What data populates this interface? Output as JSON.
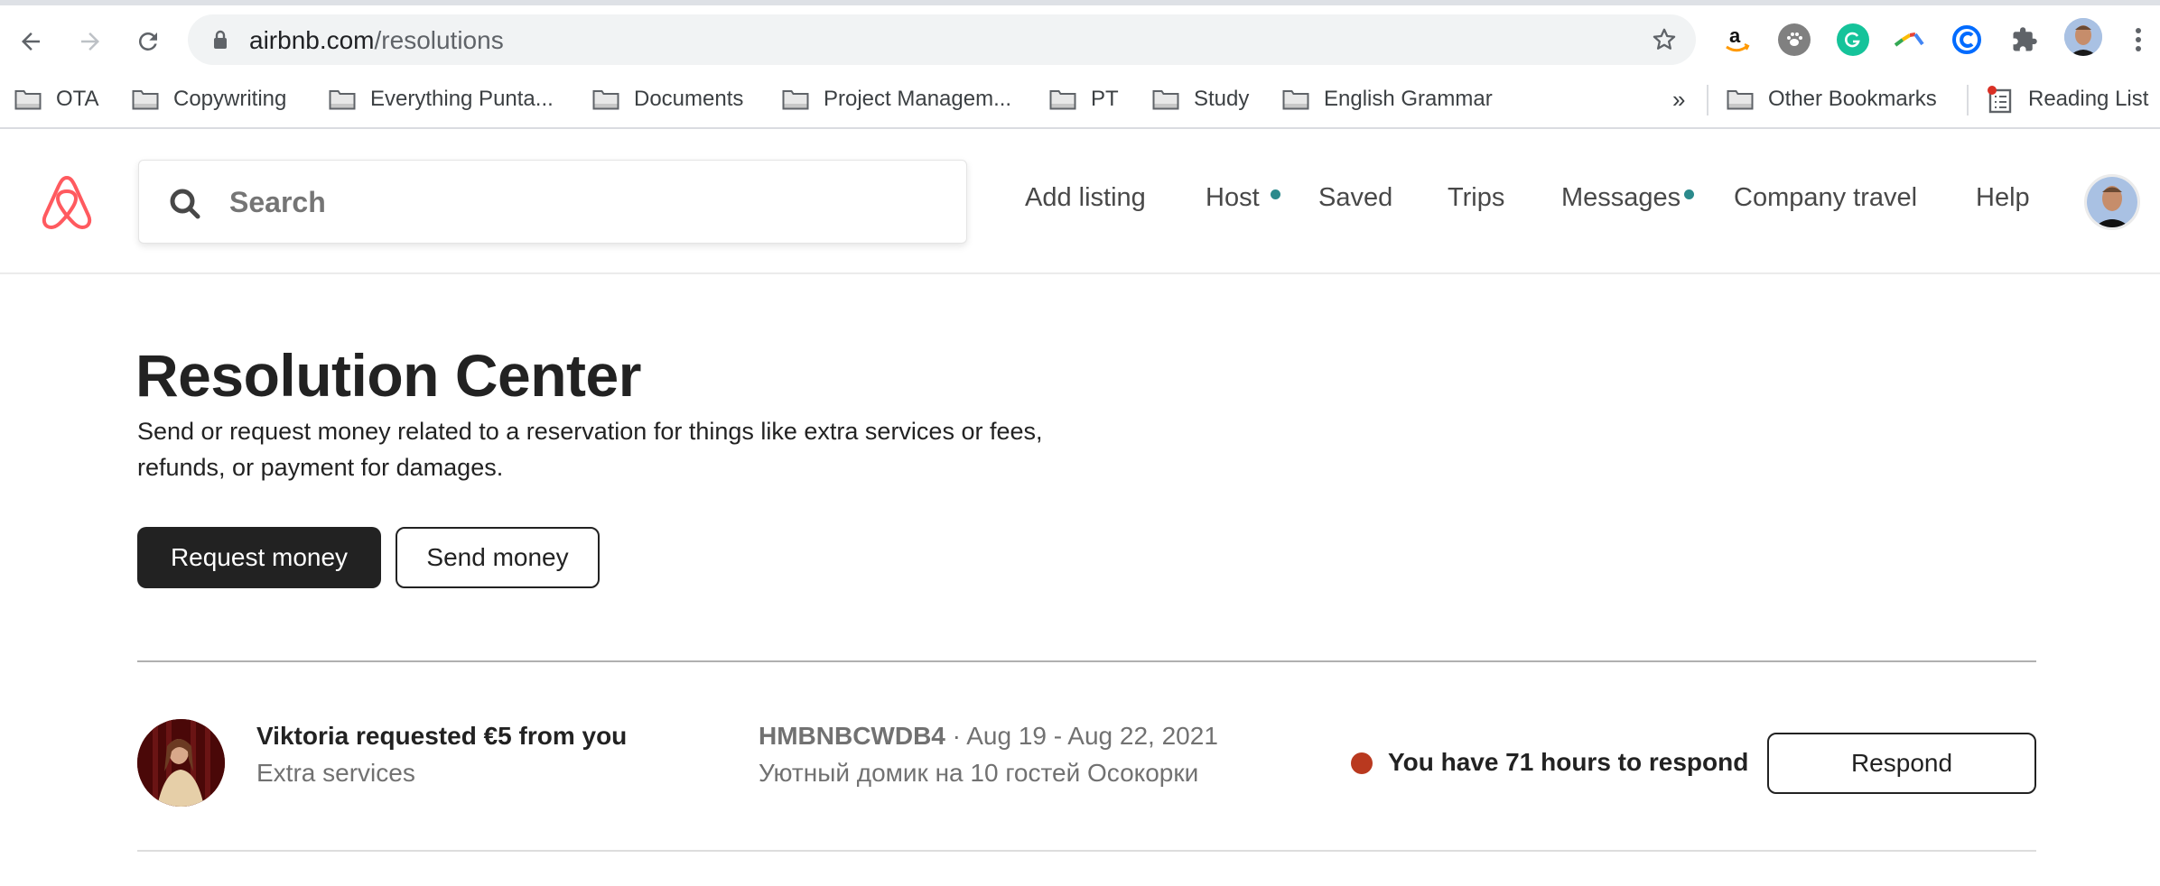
{
  "browser": {
    "url_host": "airbnb.com",
    "url_path": "/resolutions",
    "bookmarks": [
      {
        "label": "OTA",
        "icon": "folder-icon"
      },
      {
        "label": "Copywriting",
        "icon": "folder-icon"
      },
      {
        "label": "Everything Punta...",
        "icon": "folder-icon"
      },
      {
        "label": "Documents",
        "icon": "folder-icon"
      },
      {
        "label": "Project Managem...",
        "icon": "folder-icon"
      },
      {
        "label": "PT",
        "icon": "folder-icon"
      },
      {
        "label": "Study",
        "icon": "folder-icon"
      },
      {
        "label": "English Grammar",
        "icon": "folder-icon"
      }
    ],
    "overflow_label": "»",
    "other_bookmarks": "Other Bookmarks",
    "reading_list": "Reading List",
    "extensions": [
      "amazon-icon",
      "paw-icon",
      "grammarly-icon",
      "boomerang-icon",
      "calendly-icon",
      "puzzle-icon"
    ]
  },
  "header": {
    "search_placeholder": "Search",
    "nav": [
      {
        "label": "Add listing",
        "notification": false
      },
      {
        "label": "Host",
        "notification": true
      },
      {
        "label": "Saved",
        "notification": false
      },
      {
        "label": "Trips",
        "notification": false
      },
      {
        "label": "Messages",
        "notification": true
      },
      {
        "label": "Company travel",
        "notification": false
      },
      {
        "label": "Help",
        "notification": false
      }
    ]
  },
  "page": {
    "title": "Resolution Center",
    "description": "Send or request money related to a reservation for things like extra services or fees, refunds, or payment for damages.",
    "request_button": "Request money",
    "send_button": "Send money"
  },
  "requests": [
    {
      "title": "Viktoria requested €5 from you",
      "category": "Extra services",
      "confirmation_code": "HMBNBCWDB4",
      "dates": " · Aug 19 - Aug 22, 2021",
      "listing": "Уютный домик на 10 гостей Осокорки",
      "status": "You have 71 hours to respond",
      "action": "Respond"
    }
  ],
  "colors": {
    "brand": "#FF5A5F",
    "notification_dot": "#2B8A8C",
    "status_urgent": "#B9391F",
    "primary_button": "#222222"
  }
}
